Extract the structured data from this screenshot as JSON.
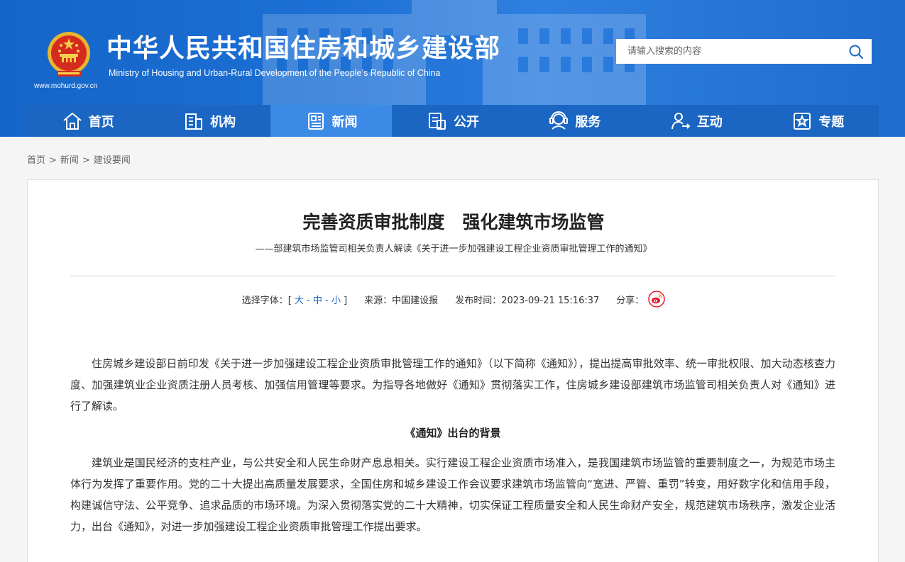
{
  "site": {
    "title": "中华人民共和国住房和城乡建设部",
    "subtitle": "Ministry of Housing and Urban-Rural Development of the People’s Republic of China",
    "url": "www.mohurd.gov.cn"
  },
  "search": {
    "placeholder": "请输入搜索的内容"
  },
  "nav": [
    {
      "label": "首页",
      "icon": "home-icon"
    },
    {
      "label": "机构",
      "icon": "building-icon"
    },
    {
      "label": "新闻",
      "icon": "news-icon"
    },
    {
      "label": "公开",
      "icon": "document-icon"
    },
    {
      "label": "服务",
      "icon": "service-icon"
    },
    {
      "label": "互动",
      "icon": "interaction-icon"
    },
    {
      "label": "专题",
      "icon": "topic-icon"
    }
  ],
  "nav_active": "新闻",
  "breadcrumb": [
    "首页",
    "新闻",
    "建设要闻"
  ],
  "breadcrumb_sep": ">",
  "article": {
    "title": "完善资质审批制度　强化建筑市场监管",
    "subtitle": "——部建筑市场监管司相关负责人解读《关于进一步加强建设工程企业资质审批管理工作的通知》",
    "meta": {
      "font_label": "选择字体：[",
      "font_large": "大",
      "font_medium": "中",
      "font_small": "小",
      "font_end": "]",
      "dash": "-",
      "source": "来源：中国建设报",
      "time": "发布时间：2023-09-21 15:16:37",
      "share": "分享："
    },
    "p1": "住房城乡建设部日前印发《关于进一步加强建设工程企业资质审批管理工作的通知》（以下简称《通知》），提出提高审批效率、统一审批权限、加大动态核查力度、加强建筑业企业资质注册人员考核、加强信用管理等要求。为指导各地做好《通知》贯彻落实工作，住房城乡建设部建筑市场监管司相关负责人对《通知》进行了解读。",
    "h1": "《通知》出台的背景",
    "p2": "建筑业是国民经济的支柱产业，与公共安全和人民生命财产息息相关。实行建设工程企业资质市场准入，是我国建筑市场监管的重要制度之一，为规范市场主体行为发挥了重要作用。党的二十大提出高质量发展要求，全国住房和城乡建设工作会议要求建筑市场监管向“宽进、严管、重罚”转变，用好数字化和信用手段，构建诚信守法、公平竞争、追求品质的市场环境。为深入贯彻落实党的二十大精神，切实保证工程质量安全和人民生命财产安全，规范建筑市场秩序，激发企业活力，出台《通知》，对进一步加强建设工程企业资质审批管理工作提出要求。"
  },
  "colors": {
    "header": "#1c6fd4",
    "nav": "#1a66c2",
    "nav_active": "#3b8ae6",
    "link": "#1a66c2"
  }
}
